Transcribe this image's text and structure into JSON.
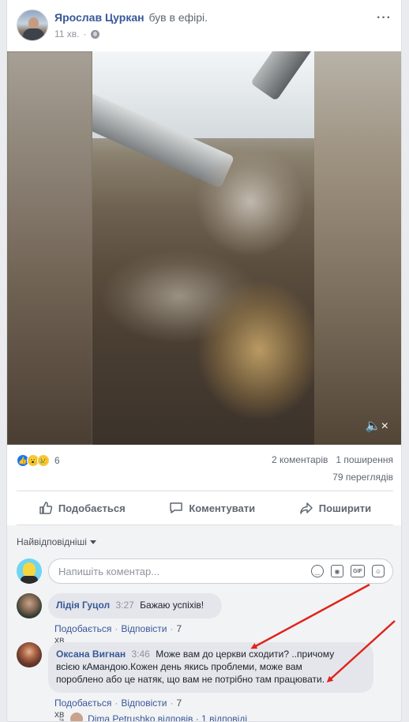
{
  "post": {
    "author": "Ярослав Цуркан",
    "action": "був в ефірі.",
    "time": "11 хв.",
    "menu_icon": "more-horizontal-icon",
    "privacy_icon": "globe-icon"
  },
  "video": {
    "mute_icon": "volume-muted-icon",
    "mute_label": "🔈×"
  },
  "stats": {
    "reactions_count": "6",
    "comments": "2 коментарів",
    "shares": "1 поширення",
    "views": "79 переглядів"
  },
  "actions": {
    "like": "Подобається",
    "comment": "Коментувати",
    "share": "Поширити"
  },
  "comments_section": {
    "sort_label": "Найвідповідніші",
    "input_placeholder": "Напишіть коментар...",
    "items": [
      {
        "name": "Лідія Гуцол",
        "time": "3:27",
        "text": "Бажаю успіхів!",
        "like": "Подобається",
        "reply": "Відповісти",
        "ago": "7 хв"
      },
      {
        "name": "Оксана Вигнан",
        "time": "3:46",
        "text_line1": "Може вам до церкви сходити? ..причому",
        "text_line2": "всією кАмандою.Кожен день якись проблеми, може вам",
        "text_line3": "пороблено або це натяк, що вам не потрібно там працювати.",
        "like": "Подобається",
        "reply": "Відповісти",
        "ago": "7 хв"
      }
    ],
    "replies_preview": "Dima Petrushko відповів · 1 відповіді"
  },
  "colors": {
    "link": "#385898",
    "bubble": "#e4e6eb",
    "arrow": "#e0241c"
  }
}
